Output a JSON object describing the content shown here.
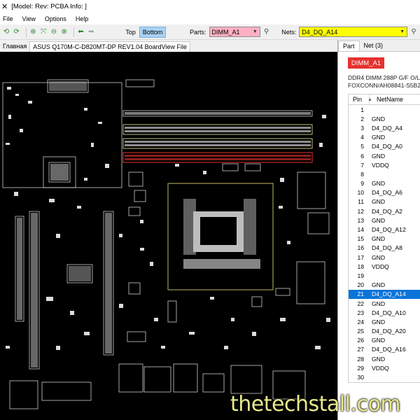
{
  "window": {
    "title": "[Model: Rev:  PCBA Info: ]"
  },
  "menu": [
    "File",
    "View",
    "Options",
    "Help"
  ],
  "toolbar": {
    "side_top": "Top",
    "side_bottom": "Bottom",
    "parts_label": "Parts:",
    "parts_value": "DIMM_A1",
    "nets_label": "Nets:",
    "nets_value": "D4_DQ_A14",
    "colors": {
      "parts_bg": "#ffb0c2",
      "nets_bg": "#ffff00",
      "active_side": "#a9d1f2"
    }
  },
  "doc_tabs": [
    "Главная",
    "ASUS Q170M-C-D820MT-DP REV1.04 BoardView File"
  ],
  "panel": {
    "tabs": [
      "Part",
      "Net (3)"
    ],
    "part_name": "DIMM_A1",
    "description_line1": "DDR4 DIMM 288P G/F O/L",
    "description_line2": "FOXCONN/AH08841-S5B2",
    "columns": {
      "pin": "Pin",
      "net": "NetName"
    },
    "selected_pin": "21",
    "pins": [
      {
        "pin": "1",
        "net": ""
      },
      {
        "pin": "2",
        "net": "GND"
      },
      {
        "pin": "3",
        "net": "D4_DQ_A4"
      },
      {
        "pin": "4",
        "net": "GND"
      },
      {
        "pin": "5",
        "net": "D4_DQ_A0"
      },
      {
        "pin": "6",
        "net": "GND"
      },
      {
        "pin": "7",
        "net": "VDDQ"
      },
      {
        "pin": "8",
        "net": ""
      },
      {
        "pin": "9",
        "net": "GND"
      },
      {
        "pin": "10",
        "net": "D4_DQ_A6"
      },
      {
        "pin": "11",
        "net": "GND"
      },
      {
        "pin": "12",
        "net": "D4_DQ_A2"
      },
      {
        "pin": "13",
        "net": "GND"
      },
      {
        "pin": "14",
        "net": "D4_DQ_A12"
      },
      {
        "pin": "15",
        "net": "GND"
      },
      {
        "pin": "16",
        "net": "D4_DQ_A8"
      },
      {
        "pin": "17",
        "net": "GND"
      },
      {
        "pin": "18",
        "net": "VDDQ"
      },
      {
        "pin": "19",
        "net": ""
      },
      {
        "pin": "20",
        "net": "GND"
      },
      {
        "pin": "21",
        "net": "D4_DQ_A14"
      },
      {
        "pin": "22",
        "net": "GND"
      },
      {
        "pin": "23",
        "net": "D4_DQ_A10"
      },
      {
        "pin": "24",
        "net": "GND"
      },
      {
        "pin": "25",
        "net": "D4_DQ_A20"
      },
      {
        "pin": "26",
        "net": "GND"
      },
      {
        "pin": "27",
        "net": "D4_DQ_A16"
      },
      {
        "pin": "28",
        "net": "GND"
      },
      {
        "pin": "29",
        "net": "VDDQ"
      },
      {
        "pin": "30",
        "net": ""
      }
    ]
  },
  "board_colors": {
    "background": "#000000",
    "outline": "#e8e8e8",
    "highlight_part": "#e6322d",
    "cpu_outline": "#d7cf6a"
  },
  "watermark": "thetechstall.com"
}
